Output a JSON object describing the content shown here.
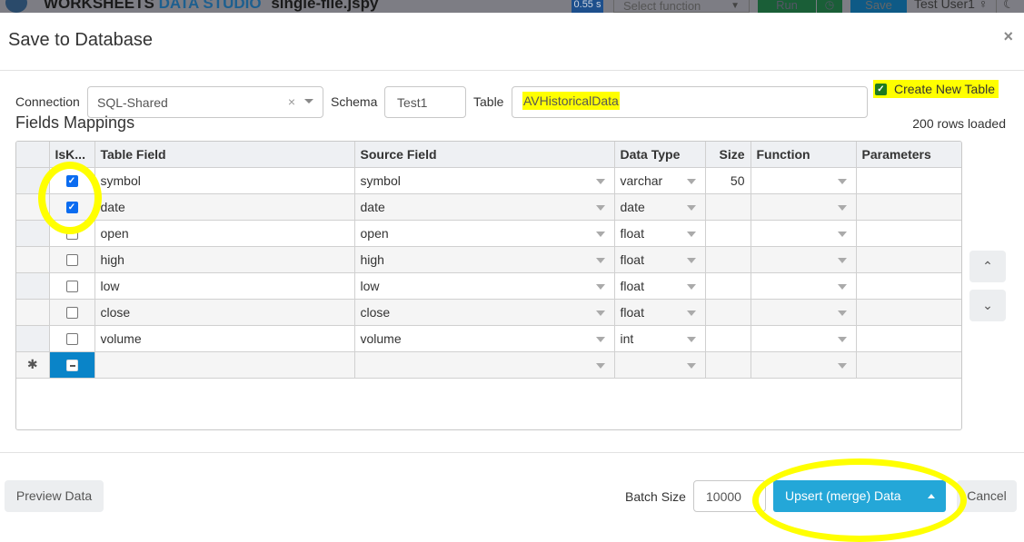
{
  "app_bar": {
    "brand_part1": "WORKSHEETS",
    "brand_part2": "DATA STUDIO",
    "file_name": "single-file.jspy",
    "timer": "0.55 s",
    "function_select_placeholder": "Select function",
    "run_label": "Run",
    "save_label": "Save",
    "user_name": "Test User1"
  },
  "modal": {
    "title": "Save to Database",
    "close_icon": "×"
  },
  "form": {
    "connection_label": "Connection",
    "connection_value": "SQL-Shared",
    "clear_icon": "×",
    "schema_label": "Schema",
    "schema_value": "Test1",
    "table_label": "Table",
    "table_value": "AVHistoricalData",
    "create_new_table_label": "Create New Table",
    "create_new_table_checked": true
  },
  "mappings": {
    "title": "Fields Mappings",
    "rows_loaded": "200 rows loaded",
    "columns": [
      "IsK...",
      "Table Field",
      "Source Field",
      "Data Type",
      "Size",
      "Function",
      "Parameters"
    ],
    "rows": [
      {
        "is_key": true,
        "table_field": "symbol",
        "source_field": "symbol",
        "data_type": "varchar",
        "size": "50",
        "function": "",
        "parameters": ""
      },
      {
        "is_key": true,
        "table_field": "date",
        "source_field": "date",
        "data_type": "date",
        "size": "",
        "function": "",
        "parameters": ""
      },
      {
        "is_key": false,
        "table_field": "open",
        "source_field": "open",
        "data_type": "float",
        "size": "",
        "function": "",
        "parameters": ""
      },
      {
        "is_key": false,
        "table_field": "high",
        "source_field": "high",
        "data_type": "float",
        "size": "",
        "function": "",
        "parameters": ""
      },
      {
        "is_key": false,
        "table_field": "low",
        "source_field": "low",
        "data_type": "float",
        "size": "",
        "function": "",
        "parameters": ""
      },
      {
        "is_key": false,
        "table_field": "close",
        "source_field": "close",
        "data_type": "float",
        "size": "",
        "function": "",
        "parameters": ""
      },
      {
        "is_key": false,
        "table_field": "volume",
        "source_field": "volume",
        "data_type": "int",
        "size": "",
        "function": "",
        "parameters": ""
      }
    ],
    "new_row_marker": "✱",
    "move_up_icon": "⌃",
    "move_down_icon": "⌄"
  },
  "footer": {
    "preview_label": "Preview Data",
    "batch_size_label": "Batch Size",
    "batch_size_value": "10000",
    "primary_action_label": "Upsert (merge) Data",
    "cancel_label": "Cancel"
  },
  "colors": {
    "primary": "#24a7d8",
    "highlight": "#ffff00",
    "selected_cell": "#0a84c8",
    "checkbox_on": "#0b6cf0"
  }
}
